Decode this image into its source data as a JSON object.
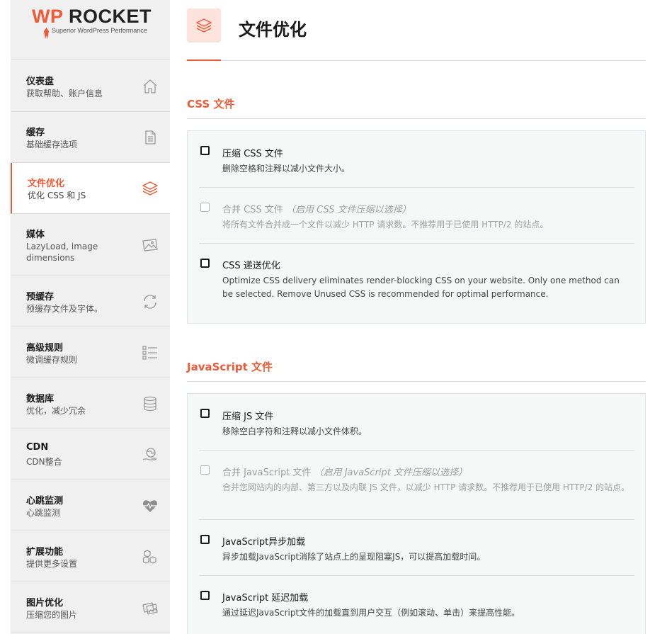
{
  "brand": {
    "name_wp": "WP",
    "name_rocket": "ROCKET",
    "tagline": "Superior WordPress Performance",
    "accent_color": "#f05a36"
  },
  "sidebar": {
    "items": [
      {
        "title": "仪表盘",
        "subtitle": "获取帮助、账户信息",
        "icon": "home-icon"
      },
      {
        "title": "缓存",
        "subtitle": "基础缓存选项",
        "icon": "document-icon"
      },
      {
        "title": "文件优化",
        "subtitle": "优化 CSS 和 JS",
        "icon": "layers-icon",
        "active": true
      },
      {
        "title": "媒体",
        "subtitle": "LazyLoad, image dimensions",
        "icon": "image-icon"
      },
      {
        "title": "预缓存",
        "subtitle": "预缓存文件及字体。",
        "icon": "refresh-icon"
      },
      {
        "title": "高级规则",
        "subtitle": "微调缓存规则",
        "icon": "checklist-icon"
      },
      {
        "title": "数据库",
        "subtitle": "优化，减少冗余",
        "icon": "database-icon"
      },
      {
        "title": "CDN",
        "subtitle": "CDN整合",
        "icon": "globe-hand-icon"
      },
      {
        "title": "心跳监测",
        "subtitle": "心跳监测",
        "icon": "heartbeat-icon"
      },
      {
        "title": "扩展功能",
        "subtitle": "提供更多设置",
        "icon": "boxes-icon"
      },
      {
        "title": "图片优化",
        "subtitle": "压缩您的图片",
        "icon": "images-icon"
      }
    ]
  },
  "header": {
    "title": "文件优化",
    "icon": "layers-icon"
  },
  "css_section": {
    "title": "CSS 文件",
    "options": [
      {
        "label": "压缩 CSS 文件",
        "note": "",
        "desc": "删除空格和注释以减小文件大小。",
        "checked": false,
        "disabled": false
      },
      {
        "label": "合并 CSS 文件",
        "note": "（启用 CSS 文件压缩以选择）",
        "desc": "将所有文件合并成一个文件以减少 HTTP 请求数。不推荐用于已使用 HTTP/2 的站点。",
        "checked": false,
        "disabled": true
      },
      {
        "label": "CSS 递送优化",
        "note": "",
        "desc": "Optimize CSS delivery eliminates render-blocking CSS on your website. Only one method can be selected. Remove Unused CSS is recommended for optimal performance.",
        "checked": false,
        "disabled": false
      }
    ]
  },
  "js_section": {
    "title": "JavaScript 文件",
    "options": [
      {
        "label": "压缩 JS 文件",
        "note": "",
        "desc": "移除空白字符和注释以减小文件体积。",
        "checked": false,
        "disabled": false
      },
      {
        "label": "合并 JavaScript 文件",
        "note": "（启用 JavaScript 文件压缩以选择）",
        "desc": "合并您网站内的内部、第三方以及内联 JS 文件，以减少 HTTP 请求数。不推荐用于已使用 HTTP/2 的站点。",
        "checked": false,
        "disabled": true
      },
      {
        "label": "JavaScript异步加载",
        "note": "",
        "desc": "异步加载JavaScript消除了站点上的呈现阻塞JS，可以提高加载时间。",
        "checked": false,
        "disabled": false
      },
      {
        "label": "JavaScript 延迟加载",
        "note": "",
        "desc": "通过延迟JavaScript文件的加载直到用户交互（例如滚动、单击）来提高性能。",
        "checked": false,
        "disabled": false
      }
    ]
  }
}
